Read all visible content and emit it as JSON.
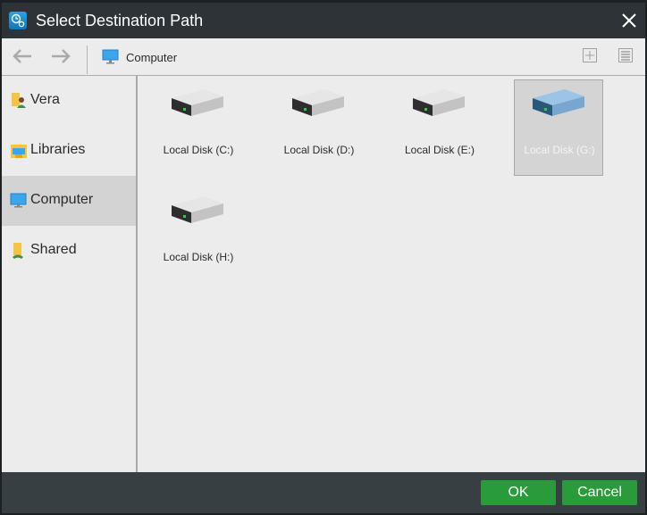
{
  "window": {
    "title": "Select Destination Path",
    "app_icon": "backup-clock-icon",
    "close_icon": "close-icon"
  },
  "toolbar": {
    "back_icon": "arrow-left-icon",
    "forward_icon": "arrow-right-icon",
    "breadcrumb": {
      "icon": "computer-icon",
      "label": "Computer"
    },
    "new_folder_icon": "plus-icon",
    "view_icon": "list-view-icon"
  },
  "sidebar": {
    "items": [
      {
        "label": "Vera",
        "icon": "user-folder-icon",
        "active": false
      },
      {
        "label": "Libraries",
        "icon": "libraries-icon",
        "active": false
      },
      {
        "label": "Computer",
        "icon": "computer-icon",
        "active": true
      },
      {
        "label": "Shared",
        "icon": "shared-folder-icon",
        "active": false
      }
    ]
  },
  "content": {
    "disks": [
      {
        "label": "Local Disk (C:)",
        "icon": "hard-drive-icon",
        "selected": false
      },
      {
        "label": "Local Disk (D:)",
        "icon": "hard-drive-icon",
        "selected": false
      },
      {
        "label": "Local Disk (E:)",
        "icon": "hard-drive-icon",
        "selected": false
      },
      {
        "label": "Local Disk (G:)",
        "icon": "hard-drive-icon",
        "selected": true
      },
      {
        "label": "Local Disk (H:)",
        "icon": "hard-drive-icon",
        "selected": false
      }
    ]
  },
  "footer": {
    "ok_label": "OK",
    "cancel_label": "Cancel"
  },
  "colors": {
    "titlebar": "#2d3336",
    "footer": "#373f43",
    "button_green": "#2a9b3a",
    "selected_bg": "#d4d4d4",
    "accent_blue": "#1e88cf"
  }
}
